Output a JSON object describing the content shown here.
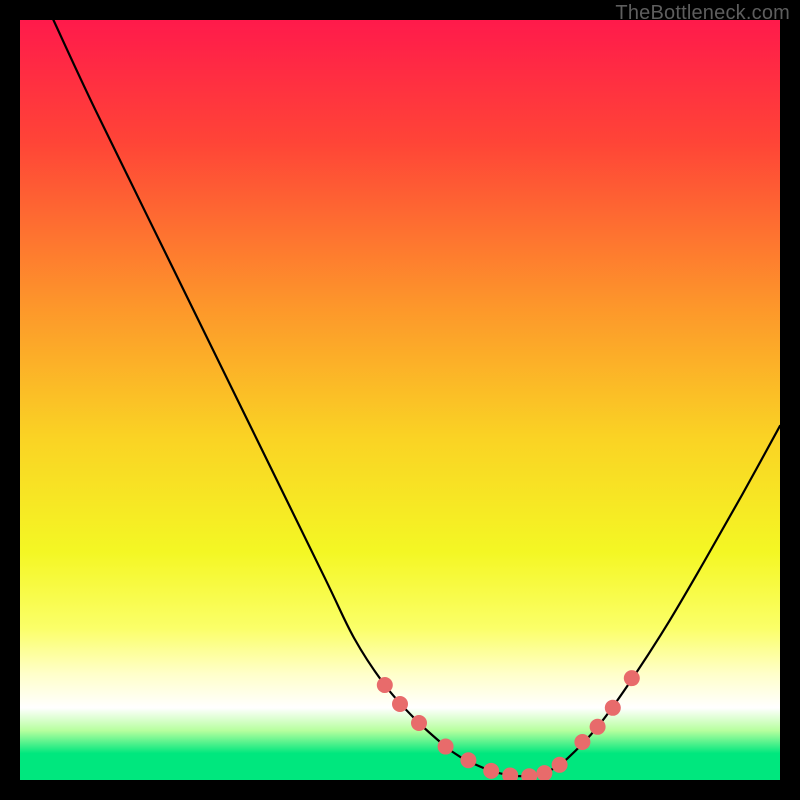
{
  "watermark": "TheBottleneck.com",
  "chart_data": {
    "type": "line",
    "title": "",
    "xlabel": "",
    "ylabel": "",
    "xlim": [
      0,
      100
    ],
    "ylim": [
      0,
      100
    ],
    "grid": false,
    "legend": false,
    "background_gradient": {
      "stops": [
        {
          "offset": 0.0,
          "color": "#ff1a4b"
        },
        {
          "offset": 0.16,
          "color": "#ff4437"
        },
        {
          "offset": 0.37,
          "color": "#fd942b"
        },
        {
          "offset": 0.55,
          "color": "#fad324"
        },
        {
          "offset": 0.7,
          "color": "#f4f724"
        },
        {
          "offset": 0.8,
          "color": "#fbff68"
        },
        {
          "offset": 0.86,
          "color": "#ffffc9"
        },
        {
          "offset": 0.905,
          "color": "#ffffff"
        },
        {
          "offset": 0.935,
          "color": "#b6ff9e"
        },
        {
          "offset": 0.965,
          "color": "#00e77e"
        },
        {
          "offset": 1.0,
          "color": "#00e77e"
        }
      ]
    },
    "series": [
      {
        "name": "bottleneck-curve",
        "stroke": "#000000",
        "stroke_width": 2.2,
        "x": [
          4.4,
          10,
          20,
          30,
          40,
          44,
          48,
          52,
          56,
          58,
          60,
          62,
          64,
          66,
          68,
          70,
          72,
          76,
          80,
          85,
          90,
          95,
          100
        ],
        "y": [
          100,
          88,
          67.6,
          47.2,
          26.8,
          18.6,
          12.5,
          8.0,
          4.4,
          3.0,
          2.0,
          1.2,
          0.7,
          0.5,
          0.7,
          1.4,
          2.8,
          7.0,
          12.5,
          20.2,
          28.7,
          37.5,
          46.6
        ]
      }
    ],
    "markers": {
      "name": "bottleneck-dots",
      "color": "#e86b6b",
      "radius": 8,
      "x": [
        48.0,
        50.0,
        52.5,
        56.0,
        59.0,
        62.0,
        64.5,
        67.0,
        69.0,
        71.0,
        74.0,
        76.0,
        78.0,
        80.5
      ],
      "y": [
        12.5,
        10.0,
        7.5,
        4.4,
        2.6,
        1.2,
        0.6,
        0.5,
        0.9,
        2.0,
        5.0,
        7.0,
        9.5,
        13.4
      ]
    }
  }
}
